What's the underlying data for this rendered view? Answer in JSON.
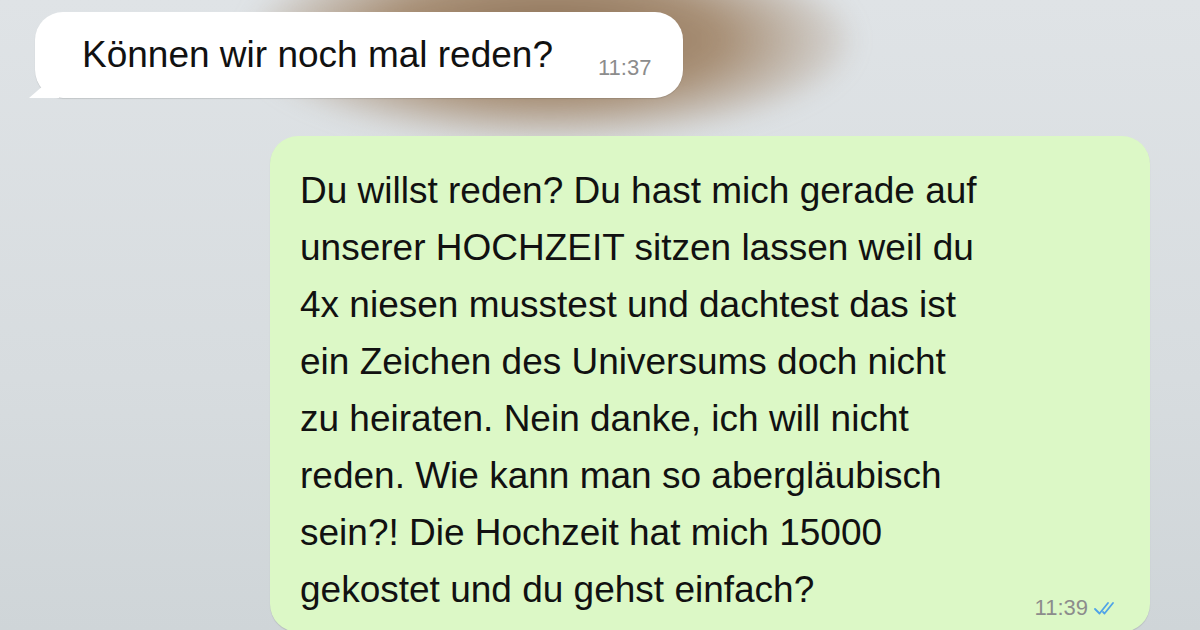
{
  "chat": {
    "messages": [
      {
        "direction": "incoming",
        "lines": [
          "Können wir noch mal reden?"
        ],
        "time": "11:37",
        "read": false
      },
      {
        "direction": "outgoing",
        "lines": [
          "Du willst reden? Du hast mich gerade auf",
          "unserer HOCHZEIT sitzen lassen weil du",
          "4x niesen musstest und dachtest das ist",
          "ein Zeichen des Universums doch nicht",
          "zu heiraten. Nein danke, ich will nicht",
          "reden. Wie kann man so abergläubisch",
          "sein?! Die Hochzeit hat mich 15000",
          "gekostet und du gehst einfach?"
        ],
        "time": "11:39",
        "read": true
      }
    ]
  }
}
